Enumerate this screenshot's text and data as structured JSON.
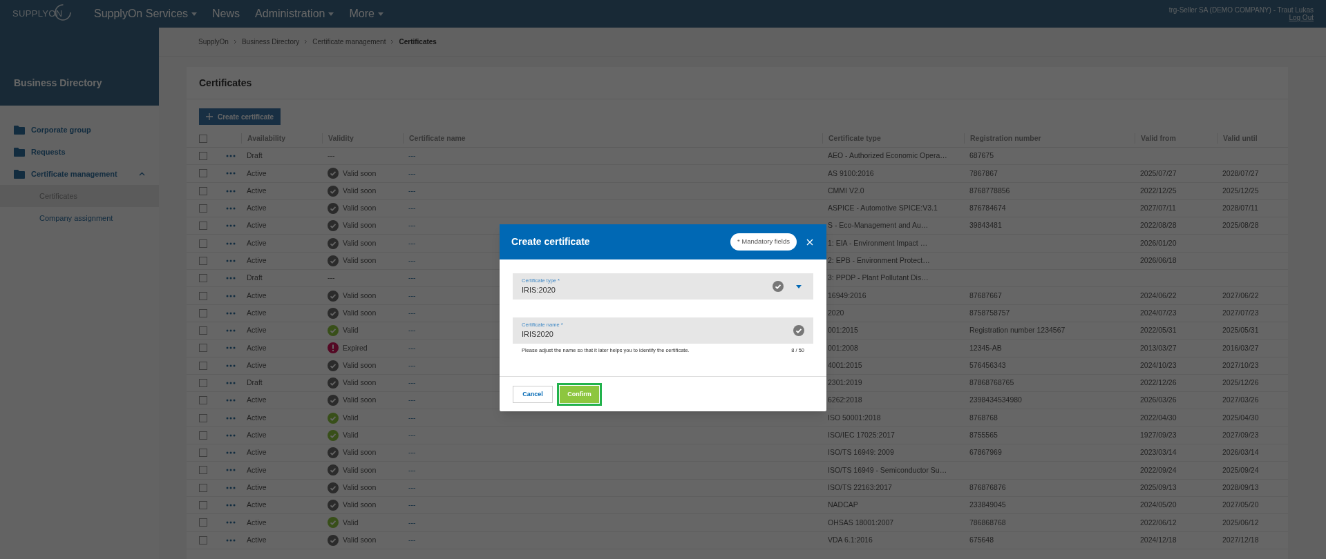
{
  "header": {
    "logo": "SUPPLYON",
    "nav": [
      {
        "label": "SupplyOn Services",
        "kind": "service"
      },
      {
        "label": "News",
        "kind": "link"
      },
      {
        "label": "Administration",
        "kind": "menu"
      },
      {
        "label": "More",
        "kind": "menu"
      }
    ],
    "user": "trg-Seller SA (DEMO COMPANY) - Traut Lukas",
    "logout": "Log Out"
  },
  "sidebar": {
    "title": "Business Directory",
    "items": [
      {
        "label": "Corporate group",
        "expanded": false
      },
      {
        "label": "Requests",
        "expanded": false
      },
      {
        "label": "Certificate management",
        "expanded": true,
        "children": [
          {
            "label": "Certificates",
            "selected": true
          },
          {
            "label": "Company assignment",
            "selected": false
          }
        ]
      }
    ]
  },
  "breadcrumb": [
    "SupplyOn",
    "Business Directory",
    "Certificate management",
    "Certificates"
  ],
  "page_title": "Certificates",
  "create_button": "Create certificate",
  "table": {
    "select_all_checked": false,
    "columns": [
      "Availability",
      "Validity",
      "Certificate name",
      "Certificate type",
      "Registration number",
      "Valid from",
      "Valid until"
    ],
    "rows": [
      {
        "checked": false,
        "availability": "Draft",
        "validity": {
          "kind": "none",
          "text": "---"
        },
        "name": "---",
        "type": "AEO - Authorized Economic Opera…",
        "reg": "687675",
        "from": "",
        "until": ""
      },
      {
        "checked": false,
        "availability": "Active",
        "validity": {
          "kind": "pending",
          "text": "Valid soon"
        },
        "name": "---",
        "type": "AS 9100:2016",
        "reg": "7867867",
        "from": "2025/07/27",
        "until": "2028/07/27"
      },
      {
        "checked": false,
        "availability": "Active",
        "validity": {
          "kind": "pending",
          "text": "Valid soon"
        },
        "name": "---",
        "type": "CMMI V2.0",
        "reg": "8768778856",
        "from": "2022/12/25",
        "until": "2025/12/25"
      },
      {
        "checked": false,
        "availability": "Active",
        "validity": {
          "kind": "pending",
          "text": "Valid soon"
        },
        "name": "---",
        "type": "ASPICE - Automotive SPICE:V3.1",
        "reg": "876784674",
        "from": "2027/07/11",
        "until": "2028/07/11"
      },
      {
        "checked": false,
        "availability": "Active",
        "validity": {
          "kind": "pending",
          "text": "Valid soon"
        },
        "name": "---",
        "type": "S - Eco-Management and Au…",
        "reg": "39843481",
        "from": "2022/08/28",
        "until": "2025/08/28"
      },
      {
        "checked": false,
        "availability": "Active",
        "validity": {
          "kind": "pending",
          "text": "Valid soon"
        },
        "name": "---",
        "type": "1: EIA - Environment Impact …",
        "reg": "",
        "from": "2026/01/20",
        "until": ""
      },
      {
        "checked": false,
        "availability": "Active",
        "validity": {
          "kind": "pending",
          "text": "Valid soon"
        },
        "name": "---",
        "type": "2: EPB - Environment Protect…",
        "reg": "",
        "from": "2026/06/18",
        "until": ""
      },
      {
        "checked": false,
        "availability": "Draft",
        "validity": {
          "kind": "none",
          "text": "---"
        },
        "name": "---",
        "type": "3: PPDP - Plant Pollutant Dis…",
        "reg": "",
        "from": "",
        "until": ""
      },
      {
        "checked": false,
        "availability": "Active",
        "validity": {
          "kind": "pending",
          "text": "Valid soon"
        },
        "name": "---",
        "type": "16949:2016",
        "reg": "87687667",
        "from": "2024/06/22",
        "until": "2027/06/22"
      },
      {
        "checked": false,
        "availability": "Active",
        "validity": {
          "kind": "pending",
          "text": "Valid soon"
        },
        "name": "---",
        "type": "2020",
        "reg": "8758758757",
        "from": "2024/07/23",
        "until": "2027/07/23"
      },
      {
        "checked": false,
        "availability": "Active",
        "validity": {
          "kind": "valid",
          "text": "Valid"
        },
        "name": "---",
        "type": "001:2015",
        "reg": "Registration number 1234567",
        "from": "2022/05/31",
        "until": "2025/05/31"
      },
      {
        "checked": false,
        "availability": "Active",
        "validity": {
          "kind": "expired",
          "text": "Expired"
        },
        "name": "---",
        "type": "001:2008",
        "reg": "12345-AB",
        "from": "2013/03/27",
        "until": "2016/03/27"
      },
      {
        "checked": false,
        "availability": "Active",
        "validity": {
          "kind": "pending",
          "text": "Valid soon"
        },
        "name": "---",
        "type": "4001:2015",
        "reg": "576456343",
        "from": "2024/10/23",
        "until": "2027/10/23"
      },
      {
        "checked": false,
        "availability": "Draft",
        "validity": {
          "kind": "pending",
          "text": "Valid soon"
        },
        "name": "---",
        "type": "2301:2019",
        "reg": "87868768765",
        "from": "2022/12/26",
        "until": "2025/12/26"
      },
      {
        "checked": false,
        "availability": "Active",
        "validity": {
          "kind": "pending",
          "text": "Valid soon"
        },
        "name": "---",
        "type": "6262:2018",
        "reg": "2398434534980",
        "from": "2026/03/26",
        "until": "2027/03/26"
      },
      {
        "checked": false,
        "availability": "Active",
        "validity": {
          "kind": "valid",
          "text": "Valid"
        },
        "name": "---",
        "type": "ISO 50001:2018",
        "reg": "8768768",
        "from": "2022/04/30",
        "until": "2025/04/30"
      },
      {
        "checked": false,
        "availability": "Active",
        "validity": {
          "kind": "valid",
          "text": "Valid"
        },
        "name": "---",
        "type": "ISO/IEC 17025:2017",
        "reg": "8755565",
        "from": "1927/09/23",
        "until": "2027/09/23"
      },
      {
        "checked": false,
        "availability": "Active",
        "validity": {
          "kind": "pending",
          "text": "Valid soon"
        },
        "name": "---",
        "type": "ISO/TS 16949: 2009",
        "reg": "67867969",
        "from": "2023/03/14",
        "until": "2026/03/14"
      },
      {
        "checked": false,
        "availability": "Active",
        "validity": {
          "kind": "pending",
          "text": "Valid soon"
        },
        "name": "---",
        "type": "ISO/TS 16949 - Semiconductor Su…",
        "reg": "",
        "from": "2022/09/24",
        "until": "2025/09/24"
      },
      {
        "checked": false,
        "availability": "Active",
        "validity": {
          "kind": "pending",
          "text": "Valid soon"
        },
        "name": "---",
        "type": "ISO/TS 22163:2017",
        "reg": "876876876",
        "from": "2025/09/13",
        "until": "2028/09/13"
      },
      {
        "checked": false,
        "availability": "Active",
        "validity": {
          "kind": "pending",
          "text": "Valid soon"
        },
        "name": "---",
        "type": "NADCAP",
        "reg": "233849045",
        "from": "2024/05/20",
        "until": "2027/05/20"
      },
      {
        "checked": false,
        "availability": "Active",
        "validity": {
          "kind": "valid",
          "text": "Valid"
        },
        "name": "---",
        "type": "OHSAS 18001:2007",
        "reg": "786868768",
        "from": "2022/06/12",
        "until": "2025/06/12"
      },
      {
        "checked": false,
        "availability": "Active",
        "validity": {
          "kind": "pending",
          "text": "Valid soon"
        },
        "name": "---",
        "type": "VDA 6.1:2016",
        "reg": "675648",
        "from": "2024/12/18",
        "until": "2027/12/18"
      }
    ]
  },
  "dialog": {
    "title": "Create certificate",
    "mandatory_note": "* Mandatory fields",
    "fields": [
      {
        "kind": "select",
        "label": "Certificate type *",
        "value": "IRIS:2020",
        "valid": true
      },
      {
        "kind": "text",
        "label": "Certificate name *",
        "value": "IRIS2020",
        "valid": true,
        "helper": "Please adjust the name so that it later helps you to identify the certificate.",
        "counter": "8 / 50"
      }
    ],
    "cancel": "Cancel",
    "confirm": "Confirm",
    "confirm_highlighted": true
  }
}
